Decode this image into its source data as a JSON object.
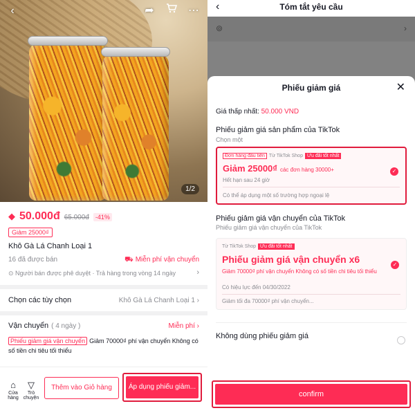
{
  "product": {
    "image_counter": "1/2",
    "price": "50.000đ",
    "old_price": "65.000đ",
    "discount": "-41%",
    "coupon_tag": "Giảm 25000₫",
    "name": "Khô Gà Lá Chanh Loại 1",
    "sold": "16 đã được bán",
    "free_shipping": "Miễn phí vận chuyển",
    "approved": "Người bán được phê duyệt · Trả hàng trong vòng 14 ngày",
    "options_label": "Chọn các tùy chọn",
    "options_value": "Khô Gà Lá Chanh Loại 1",
    "shipping_label": "Vận chuyển",
    "shipping_days": "( 4 ngày )",
    "shipping_free": "Miễn phí",
    "shipping_coupon_tag": "Phiếu giảm giá vận chuyển",
    "shipping_coupon_text": "Giảm 70000₫ phí vận chuyển Không có số tiền chi tiêu tối thiểu"
  },
  "bottom_bar": {
    "store_label": "Cửa hàng",
    "chat_label": "Trò chuyện",
    "add_to_cart": "Thêm vào Giỏ hàng",
    "apply_coupon": "Áp dụng phiếu giảm..."
  },
  "right": {
    "header_title": "Tóm tắt yêu cầu"
  },
  "sheet": {
    "title": "Phiếu giảm giá",
    "min_price_label": "Giá thấp nhất:",
    "min_price_value": "50.000 VND",
    "product_section_title": "Phiếu giảm giá sản phẩm của TikTok",
    "product_section_sub": "Chọn một",
    "voucher1": {
      "tag1": "Đơn hàng đầu tiên",
      "tag2": "Từ TikTok Shop",
      "tag3": "Ưu đãi tốt nhất",
      "big": "Giảm 25000₫",
      "condition": "các đơn hàng 30000+",
      "expiry": "Hết hạn sau 24 giờ",
      "note": "Có thể áp dụng một số trường hợp ngoại lệ"
    },
    "shipping_section_title": "Phiếu giảm giá vận chuyển của TikTok",
    "shipping_section_sub": "Phiếu giảm giá vận chuyển của TikTok",
    "voucher2": {
      "tag2": "Từ TikTok Shop",
      "tag3": "Ưu đãi tốt nhất",
      "big": "Phiếu giảm giá vận chuyển x6",
      "desc": "Giảm 70000₫ phí vận chuyển Không có số tiền chi tiêu tối thiểu",
      "validity": "Có hiệu lực đến 04/30/2022",
      "max": "Giảm tối đa 70000₫ phí vận chuyển..."
    },
    "no_coupon": "Không dùng phiếu giảm giá",
    "confirm": "confirm"
  },
  "colors": {
    "accent": "#fe2c55",
    "highlight_border": "#e01b3c"
  },
  "icons": [
    "back-icon",
    "share-icon",
    "cart-icon",
    "more-icon",
    "price-tag-icon",
    "truck-icon",
    "shield-icon",
    "chevron-right-icon",
    "store-icon",
    "chat-icon",
    "location-pin-icon",
    "close-icon",
    "check-icon"
  ]
}
